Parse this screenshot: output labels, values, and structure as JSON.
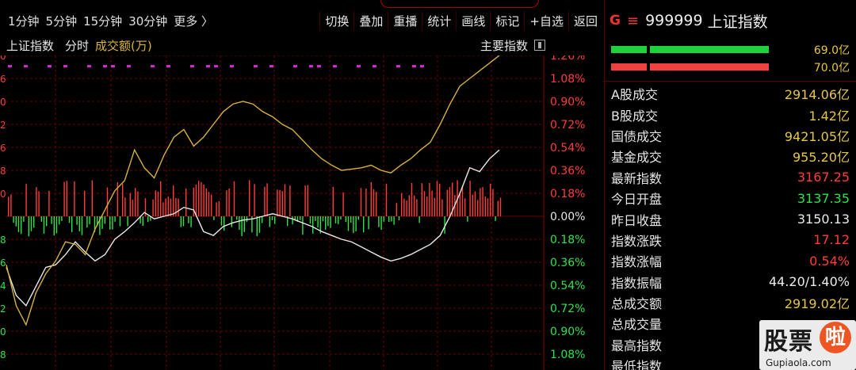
{
  "toolbar": {
    "timeframes": [
      "1分钟",
      "5分钟",
      "15分钟",
      "30分钟",
      "更多 〉"
    ],
    "tools": [
      "切换",
      "叠加",
      "重播",
      "统计",
      "画线",
      "标记",
      "+自选",
      "返回"
    ]
  },
  "chart_header": {
    "title": "上证指数",
    "mode": "分时",
    "volume_label": "成交额(万)",
    "main_indicator": "主要指数"
  },
  "chart_data": {
    "type": "line",
    "y_axis_right_labels": [
      "1.26%",
      "1.08%",
      "0.90%",
      "0.72%",
      "0.54%",
      "0.36%",
      "0.18%",
      "0.00%",
      "0.18%",
      "0.36%",
      "0.54%",
      "0.72%",
      "0.90%",
      "1.08%"
    ],
    "y_axis_right_values": [
      1.26,
      1.08,
      0.9,
      0.72,
      0.54,
      0.36,
      0.18,
      0.0,
      -0.18,
      -0.36,
      -0.54,
      -0.72,
      -0.9,
      -1.08
    ],
    "y_axis_left_labels": [
      "0",
      "6",
      "0",
      "2",
      "6",
      "8",
      "0",
      "",
      "8",
      "6",
      "4",
      "2",
      "0",
      "8"
    ],
    "series": [
      {
        "color": "#e8e8e8",
        "x": [
          0,
          2,
          4,
          6,
          8,
          10,
          12,
          14,
          16,
          18,
          20,
          22,
          24,
          26,
          28,
          30,
          32,
          34,
          36,
          38,
          40,
          42,
          44,
          46,
          48,
          50,
          52,
          54,
          56,
          58,
          60,
          62,
          64,
          66,
          68,
          70,
          72,
          74,
          76,
          78,
          80,
          82,
          84,
          86,
          88,
          90,
          92,
          94,
          96,
          98,
          100
        ],
        "values": [
          -0.4,
          -0.62,
          -0.7,
          -0.55,
          -0.4,
          -0.38,
          -0.3,
          -0.2,
          -0.28,
          -0.35,
          -0.3,
          -0.18,
          -0.12,
          -0.05,
          0.03,
          -0.02,
          0.0,
          0.02,
          0.07,
          0.05,
          -0.12,
          -0.15,
          -0.08,
          -0.05,
          -0.03,
          -0.02,
          0.0,
          0.02,
          0.0,
          -0.02,
          -0.05,
          -0.08,
          -0.12,
          -0.15,
          -0.18,
          -0.2,
          -0.24,
          -0.28,
          -0.32,
          -0.35,
          -0.33,
          -0.3,
          -0.26,
          -0.22,
          -0.15,
          0.0,
          0.18,
          0.38,
          0.35,
          0.45,
          0.52
        ]
      },
      {
        "color": "#d4b23c",
        "x": [
          0,
          2,
          4,
          6,
          8,
          10,
          12,
          14,
          16,
          18,
          20,
          22,
          24,
          26,
          28,
          30,
          32,
          34,
          36,
          38,
          40,
          42,
          44,
          46,
          48,
          50,
          52,
          54,
          56,
          58,
          60,
          62,
          64,
          66,
          68,
          70,
          72,
          74,
          76,
          78,
          80,
          82,
          84,
          86,
          88,
          90,
          92,
          94,
          96,
          98,
          100
        ],
        "values": [
          -0.38,
          -0.7,
          -0.85,
          -0.6,
          -0.45,
          -0.35,
          -0.2,
          -0.22,
          -0.3,
          -0.1,
          0.05,
          0.2,
          0.28,
          0.52,
          0.38,
          0.3,
          0.48,
          0.62,
          0.68,
          0.55,
          0.62,
          0.72,
          0.82,
          0.88,
          0.9,
          0.88,
          0.82,
          0.78,
          0.72,
          0.68,
          0.6,
          0.52,
          0.45,
          0.4,
          0.36,
          0.37,
          0.38,
          0.4,
          0.36,
          0.34,
          0.4,
          0.45,
          0.52,
          0.58,
          0.72,
          0.88,
          1.02,
          1.08,
          1.14,
          1.2,
          1.26
        ]
      }
    ],
    "ylim": [
      -1.2,
      1.3
    ],
    "grid": true
  },
  "panel": {
    "g_label": "G",
    "menu_icon": "≡",
    "code": "999999",
    "name": "上证指数",
    "bars": [
      {
        "color": "#1fd13a",
        "value": "69.0亿"
      },
      {
        "color": "#f04040",
        "value": "70.0亿"
      }
    ],
    "rows": [
      {
        "label": "A股成交",
        "value": "2914.06亿",
        "color": "yellow"
      },
      {
        "label": "B股成交",
        "value": "1.42亿",
        "color": "yellow"
      },
      {
        "label": "国债成交",
        "value": "9421.05亿",
        "color": "yellow"
      },
      {
        "label": "基金成交",
        "value": "955.20亿",
        "color": "yellow"
      },
      {
        "label": "最新指数",
        "value": "3167.25",
        "color": "red"
      },
      {
        "label": "今日开盘",
        "value": "3137.35",
        "color": "green"
      },
      {
        "label": "昨日收盘",
        "value": "3150.13",
        "color": "white"
      },
      {
        "label": "指数涨跌",
        "value": "17.12",
        "color": "red"
      },
      {
        "label": "指数涨幅",
        "value": "0.54%",
        "color": "red"
      },
      {
        "label": "指数振幅",
        "value": "44.20/1.40%",
        "color": "white"
      },
      {
        "label": "总成交额",
        "value": "2919.02亿",
        "color": "yellow"
      },
      {
        "label": "总成交量",
        "value": "",
        "color": "white"
      },
      {
        "label": "最高指数",
        "value": "",
        "color": "white"
      },
      {
        "label": "最低指数",
        "value": "",
        "color": "white"
      }
    ]
  },
  "watermark": {
    "word": "股票",
    "circle": "啦",
    "url": "Gupiaola.com"
  },
  "colors": {
    "up": "#ff3b3b",
    "down": "#2de34a",
    "grid": "#6a0000",
    "magenta": "#d02ad0"
  }
}
